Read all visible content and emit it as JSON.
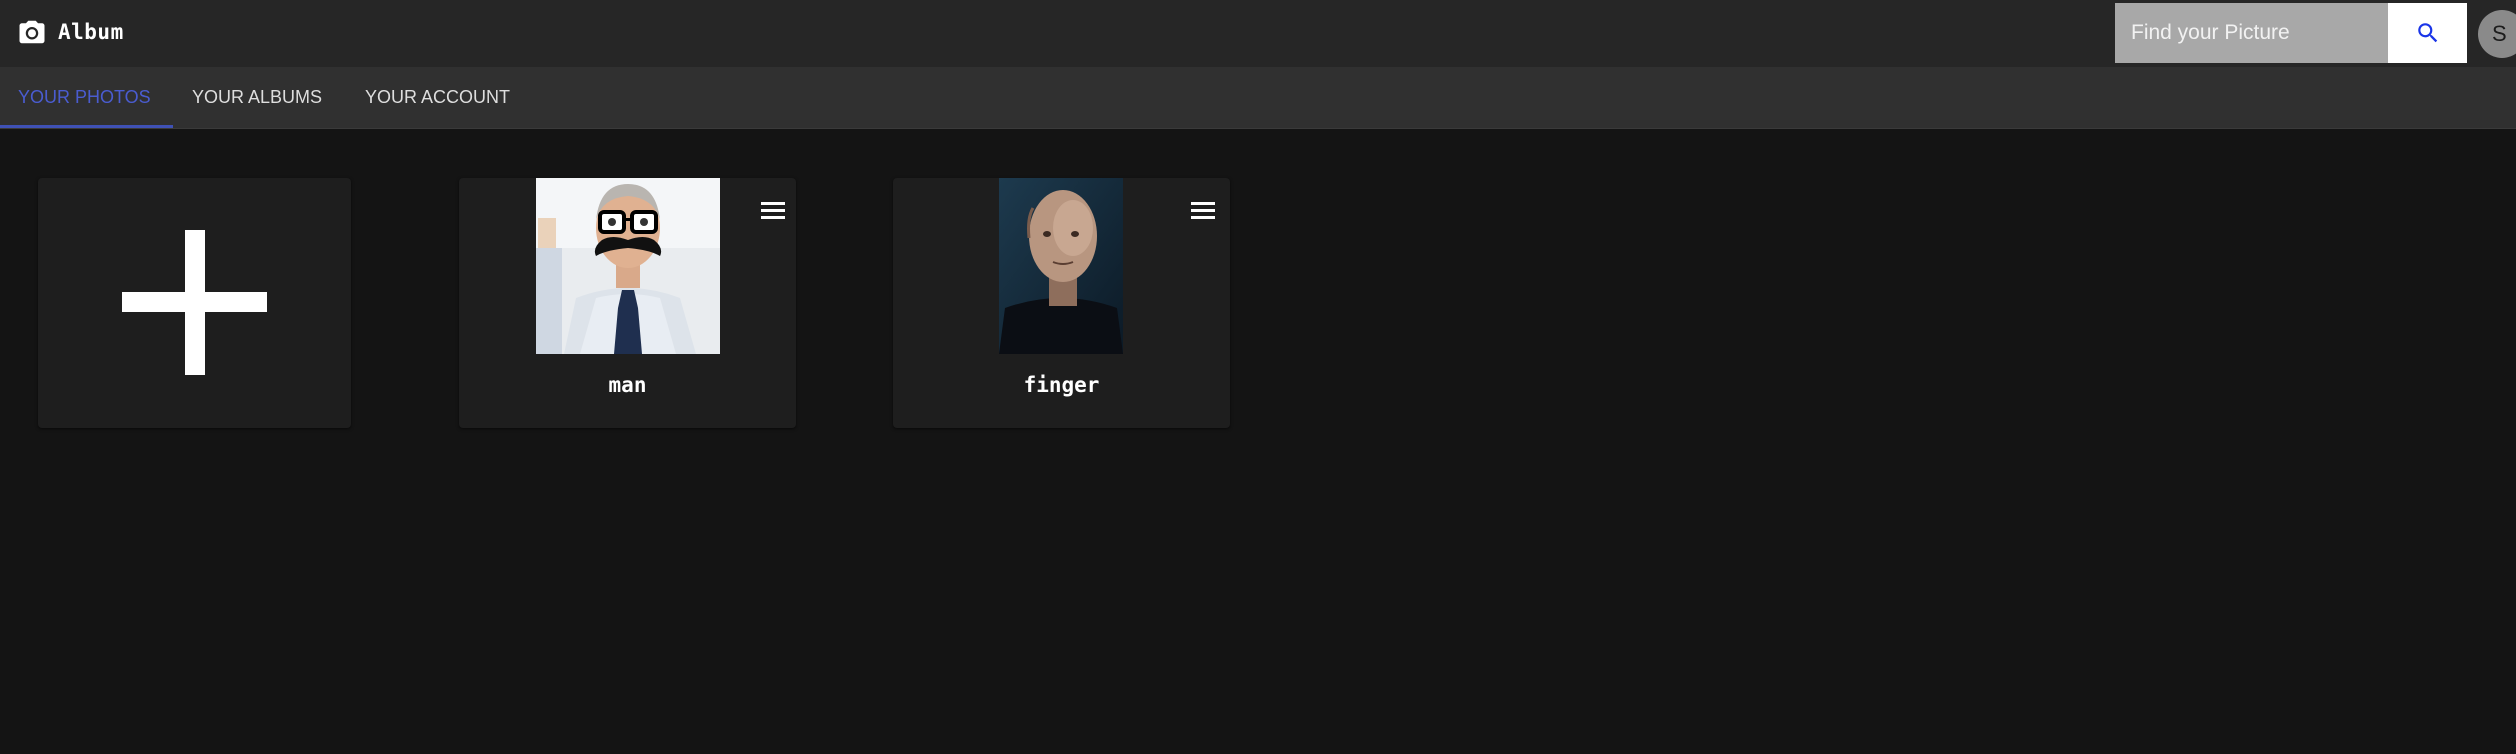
{
  "app": {
    "title": "Album",
    "logo_icon": "camera-icon"
  },
  "search": {
    "placeholder": "Find your Picture",
    "icon": "search-icon",
    "icon_color": "#1a35e8"
  },
  "user": {
    "avatar_initial": "S"
  },
  "tabs": [
    {
      "label": "YOUR PHOTOS",
      "active": true
    },
    {
      "label": "YOUR ALBUMS",
      "active": false
    },
    {
      "label": "YOUR ACCOUNT",
      "active": false
    }
  ],
  "colors": {
    "accent": "#3f51b5",
    "background": "#141414",
    "appbar": "#262626",
    "tabbar": "#303030",
    "card": "#1e1e1e"
  },
  "photos": [
    {
      "title": "man",
      "menu_icon": "hamburger-menu-icon"
    },
    {
      "title": "finger",
      "menu_icon": "hamburger-menu-icon"
    }
  ],
  "add_card": {
    "icon": "plus-icon"
  }
}
